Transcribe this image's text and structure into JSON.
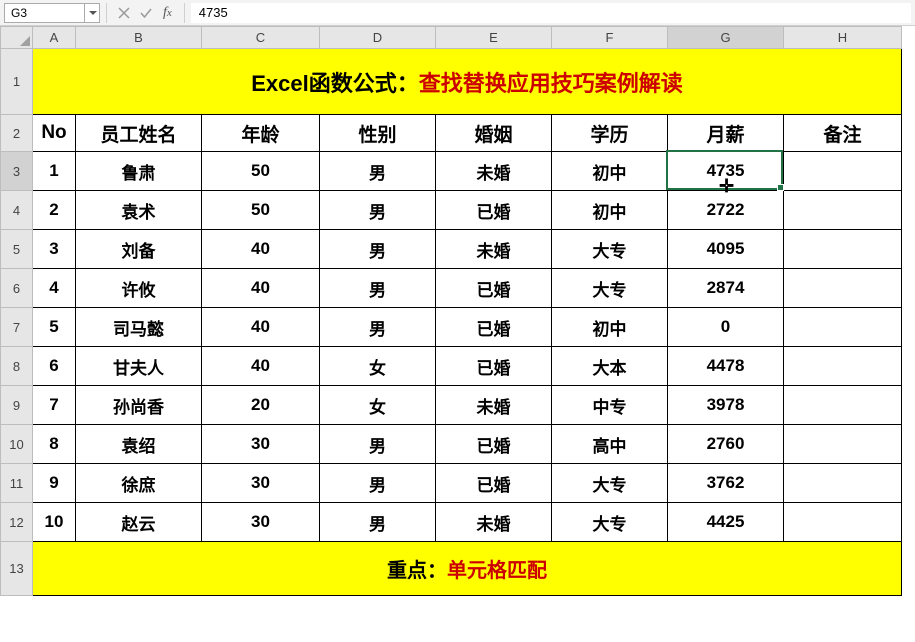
{
  "formula_bar": {
    "cell_ref": "G3",
    "formula_value": "4735"
  },
  "columns": [
    "A",
    "B",
    "C",
    "D",
    "E",
    "F",
    "G",
    "H"
  ],
  "col_widths": {
    "rowhdr": 32,
    "A": 43,
    "B": 126,
    "C": 118,
    "D": 116,
    "E": 116,
    "F": 116,
    "G": 116,
    "H": 118
  },
  "rows": [
    "1",
    "2",
    "3",
    "4",
    "5",
    "6",
    "7",
    "8",
    "9",
    "10",
    "11",
    "12",
    "13"
  ],
  "row_heights": {
    "1": 66,
    "2": 37,
    "3": 39,
    "4": 39,
    "5": 39,
    "6": 39,
    "7": 39,
    "8": 39,
    "9": 39,
    "10": 39,
    "11": 39,
    "12": 39,
    "13": 54
  },
  "active_cell": "G3",
  "title": {
    "part1": "Excel函数公式：",
    "part2": "查找替换应用技巧案例解读"
  },
  "headers": {
    "A": "No",
    "B": "员工姓名",
    "C": "年龄",
    "D": "性别",
    "E": "婚姻",
    "F": "学历",
    "G": "月薪",
    "H": "备注"
  },
  "footer": {
    "part1": "重点：",
    "part2": "单元格匹配"
  },
  "chart_data": {
    "type": "table",
    "columns": [
      "No",
      "员工姓名",
      "年龄",
      "性别",
      "婚姻",
      "学历",
      "月薪",
      "备注"
    ],
    "rows": [
      {
        "No": "1",
        "员工姓名": "鲁肃",
        "年龄": "50",
        "性别": "男",
        "婚姻": "未婚",
        "学历": "初中",
        "月薪": "4735",
        "备注": ""
      },
      {
        "No": "2",
        "员工姓名": "袁术",
        "年龄": "50",
        "性别": "男",
        "婚姻": "已婚",
        "学历": "初中",
        "月薪": "2722",
        "备注": ""
      },
      {
        "No": "3",
        "员工姓名": "刘备",
        "年龄": "40",
        "性别": "男",
        "婚姻": "未婚",
        "学历": "大专",
        "月薪": "4095",
        "备注": ""
      },
      {
        "No": "4",
        "员工姓名": "许攸",
        "年龄": "40",
        "性别": "男",
        "婚姻": "已婚",
        "学历": "大专",
        "月薪": "2874",
        "备注": ""
      },
      {
        "No": "5",
        "员工姓名": "司马懿",
        "年龄": "40",
        "性别": "男",
        "婚姻": "已婚",
        "学历": "初中",
        "月薪": "0",
        "备注": ""
      },
      {
        "No": "6",
        "员工姓名": "甘夫人",
        "年龄": "40",
        "性别": "女",
        "婚姻": "已婚",
        "学历": "大本",
        "月薪": "4478",
        "备注": ""
      },
      {
        "No": "7",
        "员工姓名": "孙尚香",
        "年龄": "20",
        "性别": "女",
        "婚姻": "未婚",
        "学历": "中专",
        "月薪": "3978",
        "备注": ""
      },
      {
        "No": "8",
        "员工姓名": "袁绍",
        "年龄": "30",
        "性别": "男",
        "婚姻": "已婚",
        "学历": "高中",
        "月薪": "2760",
        "备注": ""
      },
      {
        "No": "9",
        "员工姓名": "徐庶",
        "年龄": "30",
        "性别": "男",
        "婚姻": "已婚",
        "学历": "大专",
        "月薪": "3762",
        "备注": ""
      },
      {
        "No": "10",
        "员工姓名": "赵云",
        "年龄": "30",
        "性别": "男",
        "婚姻": "未婚",
        "学历": "大专",
        "月薪": "4425",
        "备注": ""
      }
    ]
  }
}
